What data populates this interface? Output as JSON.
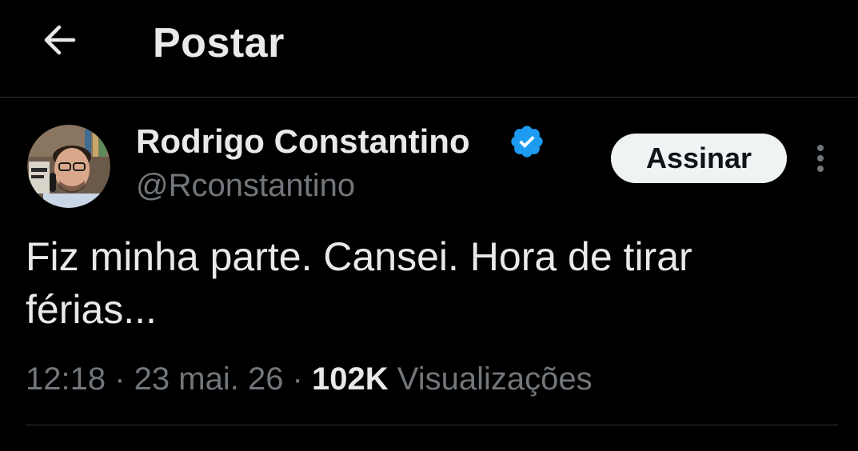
{
  "header": {
    "back_icon": "arrow-left-icon",
    "title": "Postar"
  },
  "post": {
    "author": {
      "name": "Rodrigo Constantino",
      "handle": "@Rconstantino",
      "verified": true,
      "verified_color": "#1d9bf0"
    },
    "subscribe_label": "Assinar",
    "more_icon": "more-vertical-icon",
    "text": "Fiz minha parte. Cansei. Hora de tirar férias...",
    "meta": {
      "time": "12:18",
      "separator": " · ",
      "date": "23 mai. 26",
      "views_count": "102K",
      "views_label": "Visualizações"
    }
  },
  "colors": {
    "background": "#000000",
    "text_primary": "#e7e9ea",
    "text_secondary": "#71767b",
    "divider": "#2f3336",
    "button_bg": "#eff3f4"
  }
}
